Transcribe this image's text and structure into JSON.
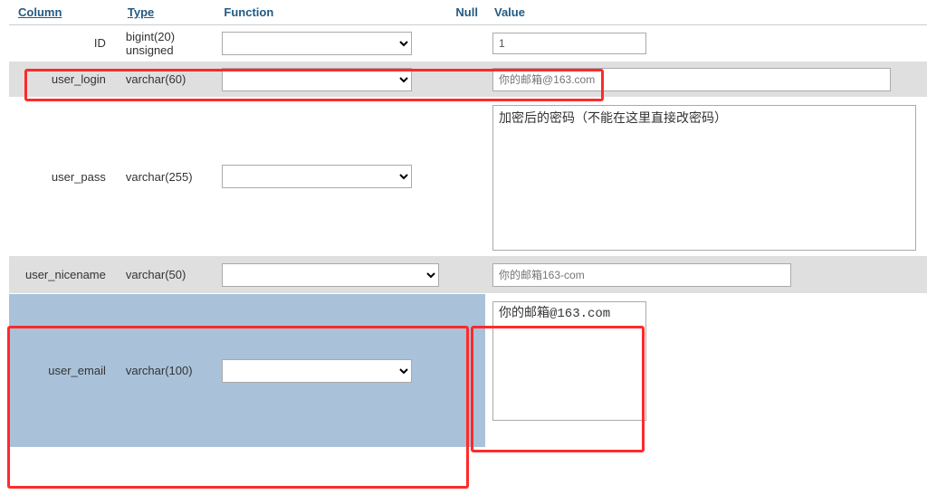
{
  "headers": {
    "column": "Column",
    "type": "Type",
    "function": "Function",
    "null": "Null",
    "value": "Value"
  },
  "rows": {
    "id": {
      "column": "ID",
      "type": "bigint(20) unsigned",
      "value": "1"
    },
    "user_login": {
      "column": "user_login",
      "type": "varchar(60)",
      "placeholder": "你的邮箱@163.com"
    },
    "user_pass": {
      "column": "user_pass",
      "type": "varchar(255)",
      "value": "加密后的密码（不能在这里直接改密码）"
    },
    "user_nicename": {
      "column": "user_nicename",
      "type": "varchar(50)",
      "placeholder": "你的邮箱163-com"
    },
    "user_email": {
      "column": "user_email",
      "type": "varchar(100)",
      "value": "你的邮箱@163.com"
    }
  }
}
